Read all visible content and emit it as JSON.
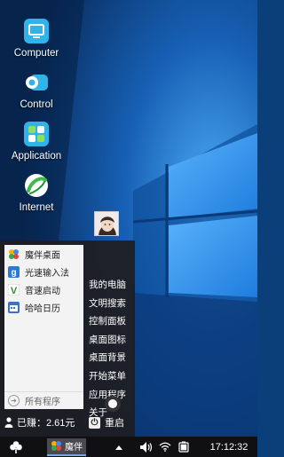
{
  "desktop": {
    "icons": [
      {
        "label": "Computer",
        "icon": "monitor-icon"
      },
      {
        "label": "Control",
        "icon": "control-panel-icon"
      },
      {
        "label": "Application",
        "icon": "apps-icon"
      },
      {
        "label": "Internet",
        "icon": "browser-globe-icon"
      }
    ]
  },
  "start_menu": {
    "programs": [
      {
        "label": "魔伴桌面",
        "icon": "mobanzhuomian-icon"
      },
      {
        "label": "光速输入法",
        "icon": "input-method-icon"
      },
      {
        "label": "音速启动",
        "icon": "quick-launch-icon"
      },
      {
        "label": "哈哈日历",
        "icon": "calendar-icon"
      }
    ],
    "all_programs": "所有程序",
    "links": [
      "我的电脑",
      "文明搜索",
      "控制面板",
      "桌面图标",
      "桌面背景",
      "开始菜单",
      "应用程序",
      "关于"
    ],
    "earned": "已赚：2.61元",
    "restart": "重启"
  },
  "taskbar": {
    "start_icon": "clover-icon",
    "active_task": "魔伴",
    "tray_icons": [
      "chevron-up-icon",
      "volume-icon",
      "wifi-icon",
      "battery-icon"
    ],
    "clock": "17:12:32"
  },
  "colors": {
    "wallpaper_dark": "#0a2a5a",
    "wallpaper_light": "#2f8be0",
    "menu_bg": "#1e1e22",
    "taskbar_bg": "#101012"
  }
}
